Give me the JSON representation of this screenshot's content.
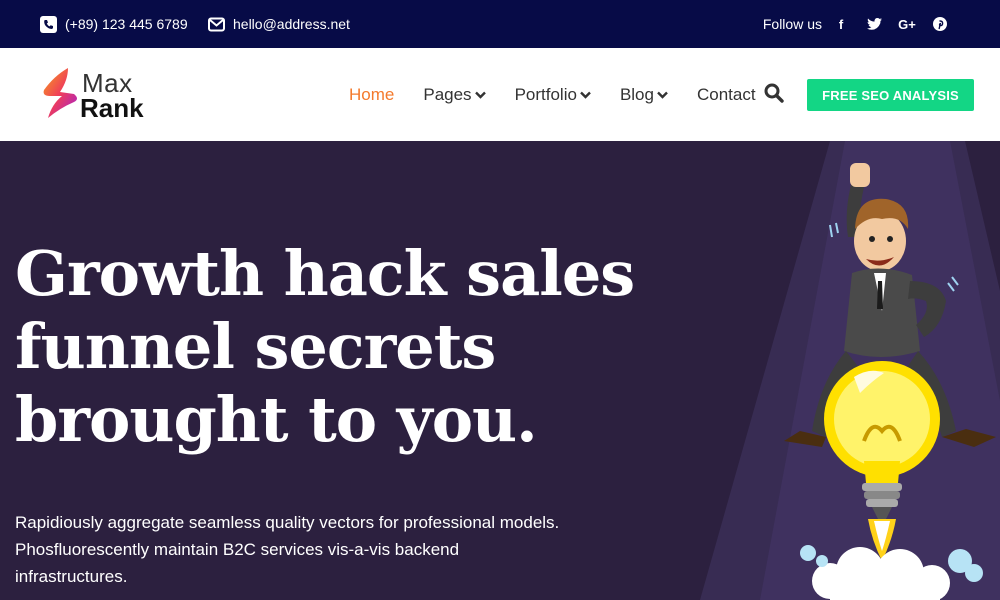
{
  "topbar": {
    "phone": "(+89) 123 445 6789",
    "email": "hello@address.net",
    "follow_label": "Follow us",
    "socials": [
      {
        "icon": "facebook-icon",
        "glyph": "f"
      },
      {
        "icon": "twitter-icon",
        "glyph": "t"
      },
      {
        "icon": "google-plus-icon",
        "glyph": "G+"
      },
      {
        "icon": "pinterest-icon",
        "glyph": "p"
      }
    ]
  },
  "header": {
    "logo_top": "Max",
    "logo_bottom": "Rank",
    "nav": [
      {
        "label": "Home",
        "active": true,
        "dropdown": false
      },
      {
        "label": "Pages",
        "active": false,
        "dropdown": true
      },
      {
        "label": "Portfolio",
        "active": false,
        "dropdown": true
      },
      {
        "label": "Blog",
        "active": false,
        "dropdown": true
      },
      {
        "label": "Contact",
        "active": false,
        "dropdown": false
      }
    ],
    "cta_label": "FREE SEO ANALYSIS"
  },
  "hero": {
    "headline_lines": [
      "Growth hack sales",
      "funnel secrets",
      "brought to you."
    ],
    "subtext_lines": [
      "Rapidiously aggregate seamless quality vectors for professional models.",
      "Phosfluorescently maintain B2C services vis-a-vis backend",
      "infrastructures."
    ]
  },
  "colors": {
    "topbar_bg": "#070b47",
    "hero_bg": "#2c203f",
    "accent_orange": "#f47a2c",
    "cta_green": "#13d685"
  }
}
